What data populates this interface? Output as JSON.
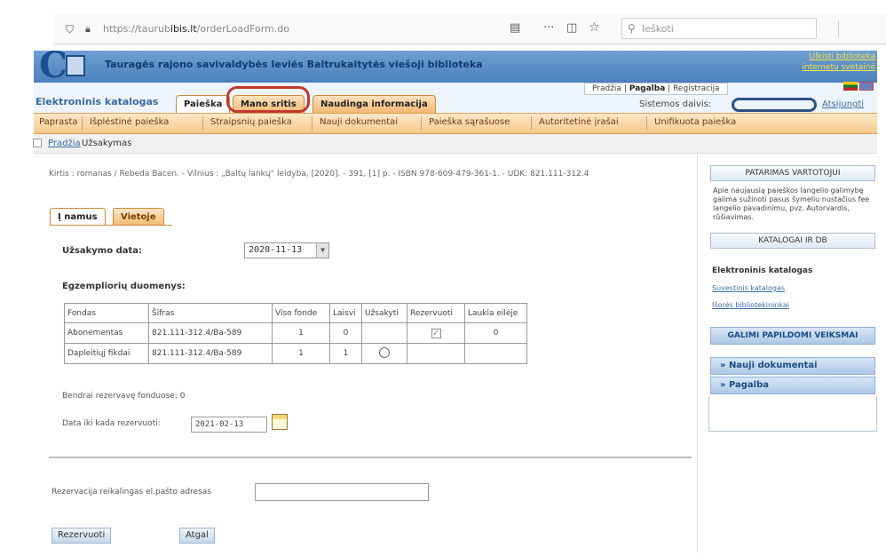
{
  "browser": {
    "url_prefix": "https://taurub",
    "url_domain": "ibis.lt",
    "url_suffix": "/orderLoadForm.do",
    "search_placeholder": "Ieškoti"
  },
  "library": {
    "title": "Tauragės rajono savivaldybės Ieviės Baltrukaitytės viešoji biblioteka",
    "link_1": "Ulkisti biblioteka",
    "link_2": "internetu svetainė",
    "catalog_label": "Elektroninis katalogas",
    "top_links": {
      "pradzia": "Pradžia",
      "sep1": "|",
      "pagalba": "Pagalba",
      "sep2": "|",
      "registracija": "Registracija"
    }
  },
  "tabs": [
    {
      "label": "Paieška",
      "active": true
    },
    {
      "label": "Mano sritis",
      "active": false
    },
    {
      "label": "Naudinga informacija",
      "active": false
    }
  ],
  "system": {
    "label": "Sistemos daivis:",
    "logout": "Atsijungti"
  },
  "menu": [
    "Paprasta",
    "Išplėstinė paieška",
    "Straipsnių paieška",
    "Nauji dokumentai",
    "Paieška sąrašuose",
    "Autoritetinė įrašai",
    "Unifikuota paieška"
  ],
  "breadcrumb": {
    "home": "Pradžia",
    "current": "Užsakymas"
  },
  "description": "Kirtis : romanas / Rebeda Bacen. - Vilnius : „Baltų lankų“ leidyba, [2020]. - 391, [1] p. - ISBN 978-609-479-361-1. - UDK: 821.111-312.4",
  "subtabs": {
    "namuo": "Į namus",
    "vietoje": "Vietoje"
  },
  "order": {
    "date_label": "Užsakymo data:",
    "date_value": "2020-11-13",
    "copies_label": "Egzempliorių duomenys:",
    "table": {
      "headers": [
        "Fondas",
        "Šifras",
        "Viso fonde",
        "Laisvi",
        "Užsakyti",
        "Rezervuoti",
        "Laukia eilėje"
      ],
      "rows": [
        {
          "fondas": "Abonementas",
          "sifras": "821.111-312.4/Ba-589",
          "viso": "1",
          "laisvi": "0",
          "laukia": "0"
        },
        {
          "fondas": "Dapleitiųj fikdai",
          "sifras": "821.111-312.4/Ba-589",
          "viso": "1",
          "laisvi": "1",
          "laukia": ""
        }
      ]
    },
    "total_reserved": "Bendrai rezervavę fonduose: 0",
    "reserve_until_label": "Data iki kada rezervuoti:",
    "reserve_until_value": "2021-02-13",
    "email_label": "Rezervacija reikalingas el.pašto adresas",
    "btn_reserve": "Rezervuoti",
    "btn_back": "Atgal"
  },
  "sidebar": {
    "advice_title": "PATARIMAS VARTOTOJUI",
    "advice_text": "Apie naujausią paieškos langelio galimybę galima sužinoti pasus šymeliu nustačius fee langelio pavadinimu, pvz. Autorvardis, rūšiavimas.",
    "catalogs_title": "KATALOGAI IR DB",
    "catalogs_bold": "Elektroninis katalogas",
    "catalogs_link_1": "Suvestinis katalogas",
    "catalogs_link_2": "Išorės bibliotekininkai",
    "actions_title": "GALIMI PAPILDOMI VEIKSMAI",
    "action_1": "» Nauji dokumentai",
    "action_2": "» Pagalba"
  }
}
